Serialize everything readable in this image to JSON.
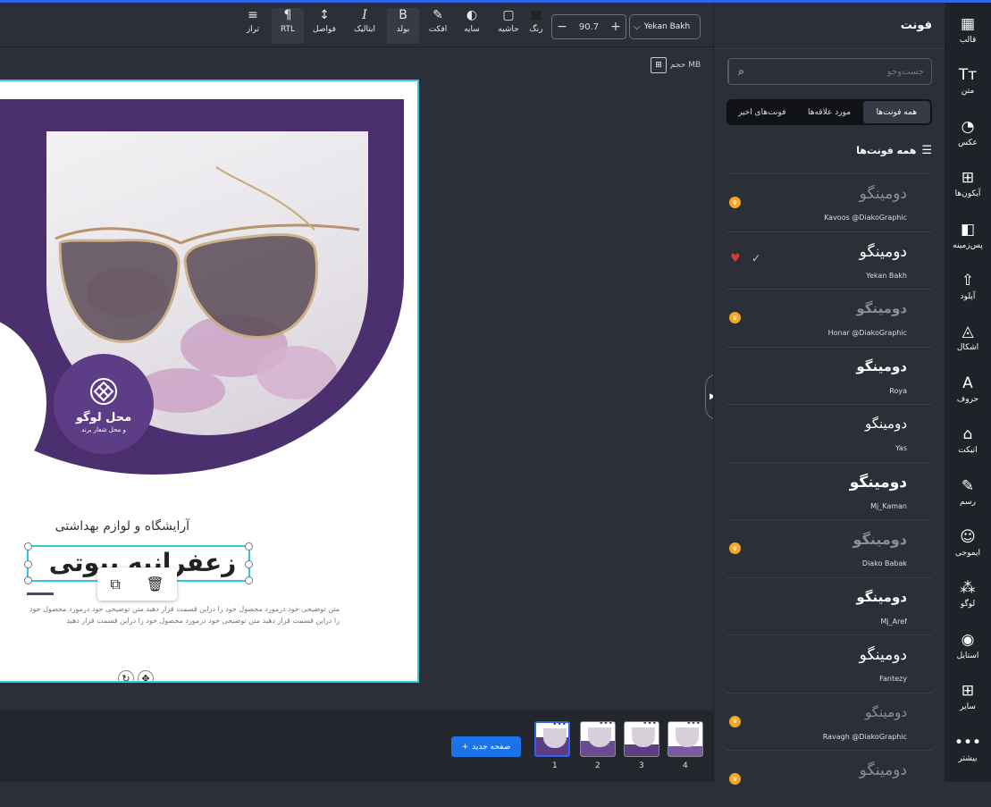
{
  "toolbar": {
    "items": [
      {
        "label": "تراز",
        "icon": "align-icon",
        "glyph": "≡"
      },
      {
        "label": "RTL",
        "icon": "rtl-icon",
        "glyph": "¶"
      },
      {
        "label": "فواصل",
        "icon": "spacing-icon",
        "glyph": "↕"
      },
      {
        "label": "ایتالیک",
        "icon": "italic-icon",
        "glyph": "I"
      },
      {
        "label": "بولد",
        "icon": "bold-icon",
        "glyph": "B"
      },
      {
        "label": "افکت",
        "icon": "effect-icon",
        "glyph": "✎"
      },
      {
        "label": "سایه",
        "icon": "shadow-icon",
        "glyph": "◐"
      },
      {
        "label": "حاشیه",
        "icon": "border-icon",
        "glyph": "▢"
      },
      {
        "label": "رنگ",
        "icon": "color-icon",
        "glyph": "■"
      }
    ],
    "zoom_value": "90.7",
    "zoom_minus": "−",
    "zoom_plus": "+",
    "font_name": "Yekan Bakh",
    "size_label": "حجم MB"
  },
  "canvas": {
    "logo_title": "محل لوگو",
    "logo_subtitle": "و محل شعار برند",
    "subtitle": "آرایشگاه و لوازم بهداشتی",
    "headline": "زعفرانیه بیوتی",
    "body": "متن توضیحی خود درمورد محصول خود را دراین قسمت قرار دهید متن توضیحی خود درمورد محصول خود را دراین قسمت قرار دهید متن توضیحی خود درمورد محصول خود را دراین قسمت قرار دهید"
  },
  "pages": {
    "add_label": "صفحه جدید",
    "thumbs": [
      {
        "num": "1",
        "active": true
      },
      {
        "num": "2",
        "active": false
      },
      {
        "num": "3",
        "active": false
      },
      {
        "num": "4",
        "active": false
      }
    ]
  },
  "panel": {
    "title": "فونت",
    "search_placeholder": "جست‌وجو",
    "tabs": [
      {
        "label": "همه فونت‌ها",
        "active": true
      },
      {
        "label": "مورد علاقه‌ها",
        "active": false
      },
      {
        "label": "فونت‌های اخیر",
        "active": false
      }
    ],
    "list_title": "همه فونت‌ها",
    "fonts": [
      {
        "sample": "دومینگو",
        "name": "Kavoos @DiakoGraphic",
        "premium": true,
        "sample_color": "#8a8e98"
      },
      {
        "sample": "دومینگو",
        "name": "Yekan Bakh",
        "premium": false,
        "selected": true,
        "sample_color": "#ffffff"
      },
      {
        "sample": "دومینگو",
        "name": "Honar @DiakoGraphic",
        "premium": true,
        "sample_color": "#8a8e98"
      },
      {
        "sample": "دومینگو",
        "name": "Roya",
        "premium": false,
        "sample_color": "#ffffff"
      },
      {
        "sample": "دومینگو",
        "name": "Yas",
        "premium": false,
        "sample_color": "#ffffff"
      },
      {
        "sample": "دومینگو",
        "name": "Mj_Kaman",
        "premium": false,
        "sample_color": "#ffffff"
      },
      {
        "sample": "دومینگو",
        "name": "Diako Babak",
        "premium": true,
        "sample_color": "#8a8e98"
      },
      {
        "sample": "دومینگو",
        "name": "Mj_Aref",
        "premium": false,
        "sample_color": "#ffffff"
      },
      {
        "sample": "دومینگو",
        "name": "Fantezy",
        "premium": false,
        "sample_color": "#ffffff"
      },
      {
        "sample": "دومینگو",
        "name": "Ravagh @DiakoGraphic",
        "premium": true,
        "sample_color": "#8a8e98"
      },
      {
        "sample": "دومینگو",
        "name": "",
        "premium": true,
        "sample_color": "#8a8e98"
      }
    ]
  },
  "nav": [
    {
      "label": "قالب",
      "icon": "template-icon",
      "glyph": "▦"
    },
    {
      "label": "متن",
      "icon": "text-icon",
      "glyph": "Tт"
    },
    {
      "label": "عکس",
      "icon": "photo-icon",
      "glyph": "◔"
    },
    {
      "label": "آیکون‌ها",
      "icon": "icons-icon",
      "glyph": "⊞"
    },
    {
      "label": "پس‌زمینه",
      "icon": "background-icon",
      "glyph": "◧"
    },
    {
      "label": "آپلود",
      "icon": "upload-icon",
      "glyph": "⇧"
    },
    {
      "label": "اشکال",
      "icon": "shapes-icon",
      "glyph": "◬"
    },
    {
      "label": "حروف",
      "icon": "letters-icon",
      "glyph": "A"
    },
    {
      "label": "اتیکت",
      "icon": "label-icon",
      "glyph": "⌂"
    },
    {
      "label": "رسم",
      "icon": "draw-icon",
      "glyph": "✎"
    },
    {
      "label": "ایموجی",
      "icon": "emoji-icon",
      "glyph": "☺"
    },
    {
      "label": "لوگو",
      "icon": "logo-icon",
      "glyph": "⁂"
    },
    {
      "label": "استایل",
      "icon": "style-icon",
      "glyph": "◉"
    },
    {
      "label": "سایر",
      "icon": "more-shapes-icon",
      "glyph": "⊞"
    },
    {
      "label": "بیشتر",
      "icon": "more-icon",
      "glyph": "•••"
    }
  ],
  "colors": {
    "accent": "#2f63e8",
    "brand_purple": "#4c2f6e",
    "selection": "#36c7d6",
    "button_blue": "#1a73e8"
  }
}
